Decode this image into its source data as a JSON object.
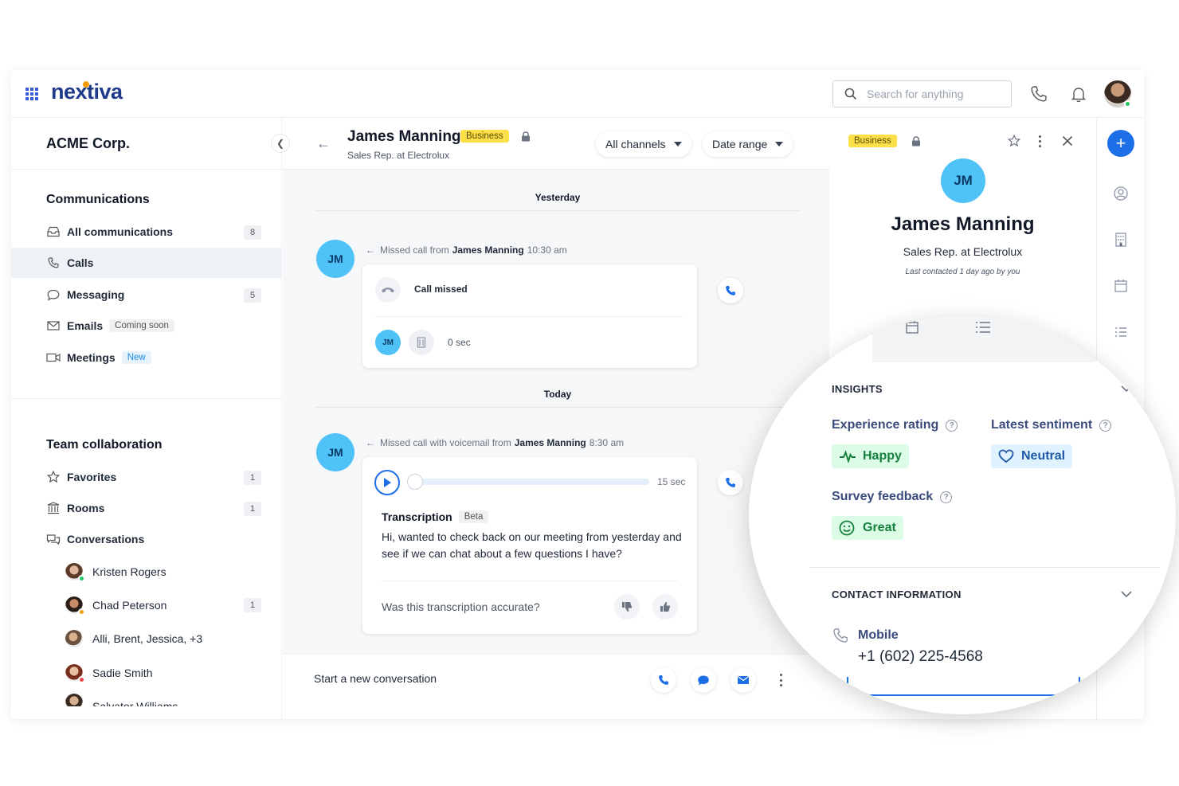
{
  "brand": {
    "logo": "nextiva"
  },
  "topbar": {
    "search_placeholder": "Search for anything"
  },
  "sidebar": {
    "org": "ACME Corp.",
    "communications_title": "Communications",
    "items": [
      {
        "label": "All communications",
        "count": "8"
      },
      {
        "label": "Calls"
      },
      {
        "label": "Messaging",
        "count": "5"
      },
      {
        "label": "Emails",
        "tag": "Coming soon"
      },
      {
        "label": "Meetings",
        "tag": "New"
      }
    ],
    "team_title": "Team collaboration",
    "team_items": [
      {
        "label": "Favorites",
        "count": "1"
      },
      {
        "label": "Rooms",
        "count": "1"
      },
      {
        "label": "Conversations"
      }
    ],
    "conversations": [
      {
        "name": "Kristen Rogers"
      },
      {
        "name": "Chad Peterson",
        "count": "1"
      },
      {
        "name": "Alli, Brent, Jessica, +3"
      },
      {
        "name": "Sadie Smith"
      },
      {
        "name": "Salvator Williams"
      }
    ]
  },
  "conversation": {
    "name": "James Manning",
    "badge": "Business",
    "subtitle": "Sales Rep. at Electrolux",
    "filter_channels": "All channels",
    "filter_date": "Date range",
    "day1": "Yesterday",
    "event1": {
      "prefix": "Missed call from",
      "who": "James Manning",
      "time": "10:30 am"
    },
    "card1": {
      "title": "Call missed",
      "initials": "JM",
      "duration": "0 sec"
    },
    "day2": "Today",
    "event2": {
      "prefix": "Missed call with voicemail from",
      "who": "James Manning",
      "time": "8:30 am"
    },
    "card2": {
      "length": "15 sec",
      "transcription_label": "Transcription",
      "beta": "Beta",
      "text": "Hi, wanted to check back on our meeting from yesterday and see if we can chat about a few questions I have?",
      "accuracy_q": "Was this transcription accurate?"
    },
    "avatar_initials": "JM",
    "compose_placeholder": "Start a new conversation"
  },
  "contact": {
    "badge": "Business",
    "initials": "JM",
    "name": "James Manning",
    "title": "Sales Rep. at Electrolux",
    "last_contacted": "Last contacted 1 day ago by you"
  },
  "insights": {
    "header": "INSIGHTS",
    "experience_label": "Experience rating",
    "experience_value": "Happy",
    "sentiment_label": "Latest sentiment",
    "sentiment_value": "Neutral",
    "survey_label": "Survey feedback",
    "survey_value": "Great",
    "help_glyph": "?"
  },
  "contact_info": {
    "header": "CONTACT INFORMATION",
    "mobile_label": "Mobile",
    "mobile_value": "+1 (602) 225-4568"
  },
  "colors": {
    "brand_blue": "#1d6fe8",
    "avatar_blue": "#4fc3f7",
    "badge_yellow": "#fde047"
  }
}
